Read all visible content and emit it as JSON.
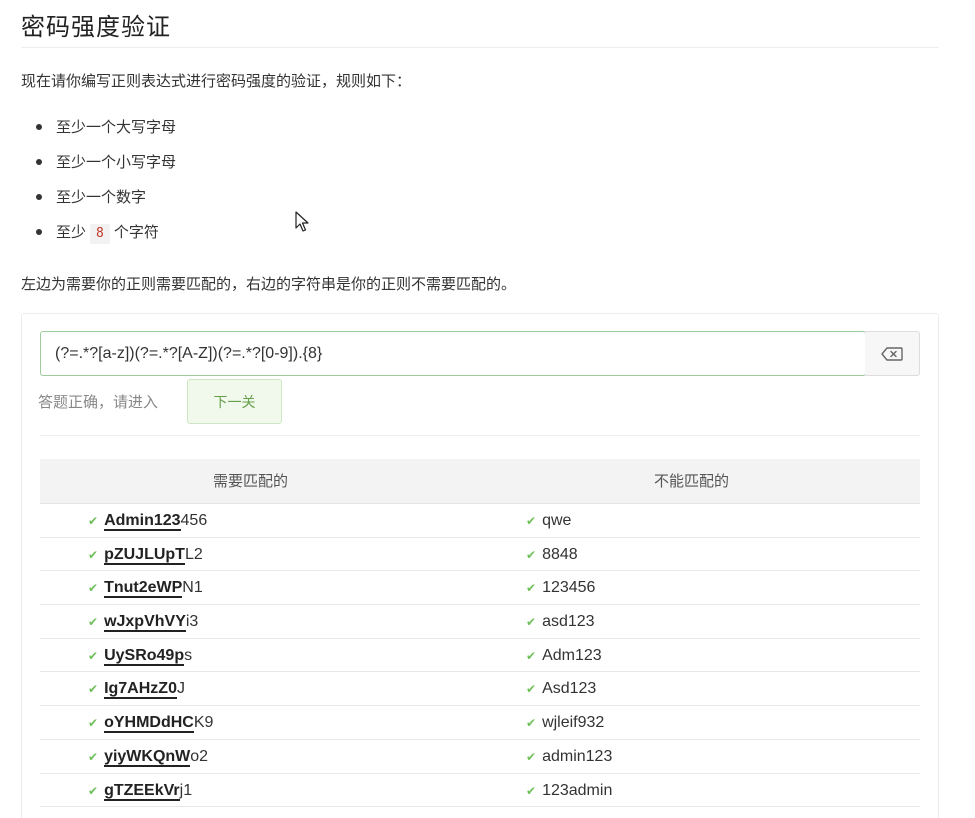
{
  "page": {
    "title": "密码强度验证",
    "intro": "现在请你编写正则表达式进行密码强度的验证，规则如下：",
    "rules": [
      {
        "text": "至少一个大写字母"
      },
      {
        "text": "至少一个小写字母"
      },
      {
        "text": "至少一个数字"
      },
      {
        "prefix": "至少",
        "code": "8",
        "suffix": "个字符"
      }
    ],
    "note": "左边为需要你的正则需要匹配的，右边的字符串是你的正则不需要匹配的。"
  },
  "editor": {
    "regex_value": "(?=.*?[a-z])(?=.*?[A-Z])(?=.*?[0-9]).{8}",
    "clear_icon": "backspace-icon",
    "result_text": "答题正确，请进入",
    "next_button": "下一关"
  },
  "table": {
    "headers": {
      "left": "需要匹配的",
      "right": "不能匹配的"
    },
    "rows": [
      {
        "left_match": "Admin123",
        "left_rest": "456",
        "right": "qwe"
      },
      {
        "left_match": "pZUJLUpT",
        "left_rest": "L2",
        "right": "8848"
      },
      {
        "left_match": "Tnut2eWP",
        "left_rest": "N1",
        "right": "123456"
      },
      {
        "left_match": "wJxpVhVY",
        "left_rest": "i3",
        "right": "asd123"
      },
      {
        "left_match": "UySRo49p",
        "left_rest": "s",
        "right": "Adm123"
      },
      {
        "left_match": "Ig7AHzZ0",
        "left_rest": "J",
        "right": "Asd123"
      },
      {
        "left_match": "oYHMDdHC",
        "left_rest": "K9",
        "right": "wjleif932"
      },
      {
        "left_match": "yiyWKQnW",
        "left_rest": "o2",
        "right": "admin123"
      },
      {
        "left_match": "gTZEEkVr",
        "left_rest": "j1",
        "right": "123admin"
      }
    ],
    "check_icon": "check-icon"
  },
  "colors": {
    "accent_green": "#6fbf5a",
    "input_border": "#9ccc9c",
    "code_text": "#c0392b"
  }
}
